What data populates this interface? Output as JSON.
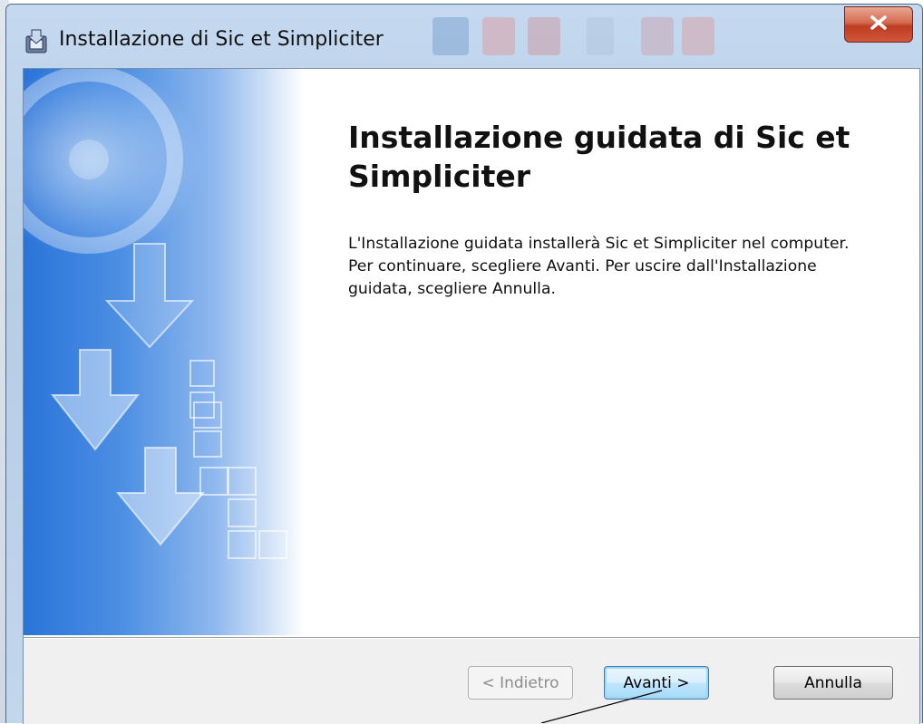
{
  "window": {
    "title": "Installazione di Sic et Simpliciter",
    "close_icon": "close-x-icon",
    "app_icon": "installer-icon"
  },
  "welcome": {
    "heading": "Installazione guidata di Sic et Simpliciter",
    "body": "L'Installazione guidata installerà Sic et Simpliciter nel computer. Per continuare, scegliere Avanti. Per uscire dall'Installazione guidata, scegliere Annulla."
  },
  "buttons": {
    "back": {
      "label": "< Indietro",
      "enabled": false
    },
    "next": {
      "label": "Avanti >",
      "enabled": true,
      "default": true
    },
    "cancel": {
      "label": "Annulla",
      "enabled": true
    }
  },
  "colors": {
    "banner_blue": "#2a74d9",
    "close_red": "#c8452b",
    "default_button_border": "#3c7fb1"
  }
}
